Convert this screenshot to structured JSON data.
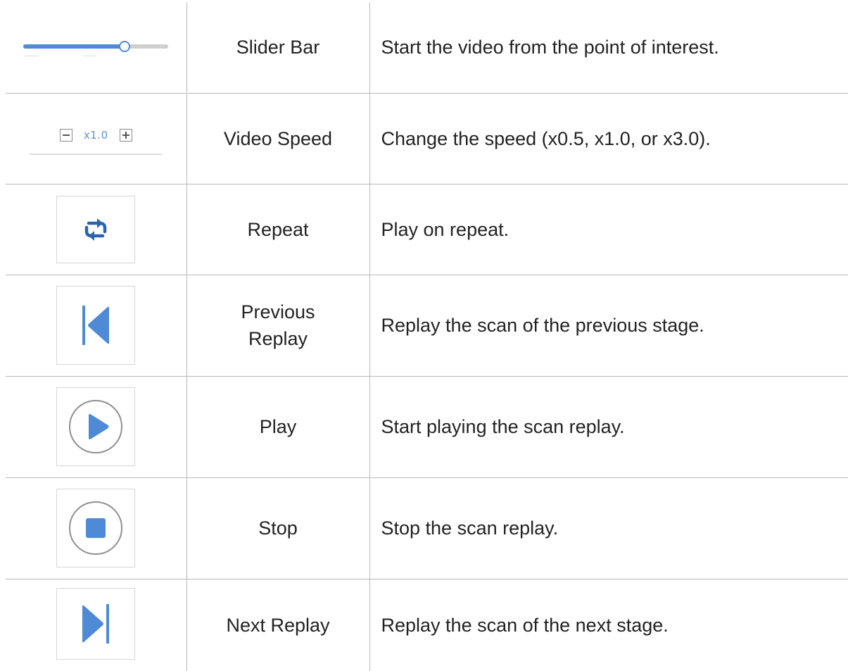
{
  "colors": {
    "accent": "#4f8ad6",
    "repeat_icon": "#2a64b0",
    "border": "#b8b8b8"
  },
  "rows": [
    {
      "icon": "slider-bar",
      "name": "Slider Bar",
      "description": "Start the video from the point of interest.",
      "slider_progress": 0.7
    },
    {
      "icon": "video-speed-control",
      "name": "Video Speed",
      "description": "Change the speed (x0.5, x1.0, or x3.0).",
      "speed_value": "x1.0"
    },
    {
      "icon": "repeat-icon",
      "name": "Repeat",
      "description": "Play on repeat."
    },
    {
      "icon": "previous-replay-icon",
      "name_line1": "Previous",
      "name_line2": "Replay",
      "description": "Replay the scan of the previous stage."
    },
    {
      "icon": "play-icon",
      "name": "Play",
      "description": "Start playing the scan replay."
    },
    {
      "icon": "stop-icon",
      "name": "Stop",
      "description": "Stop the scan replay."
    },
    {
      "icon": "next-replay-icon",
      "name": "Next Replay",
      "description": "Replay the scan of the next stage."
    }
  ]
}
